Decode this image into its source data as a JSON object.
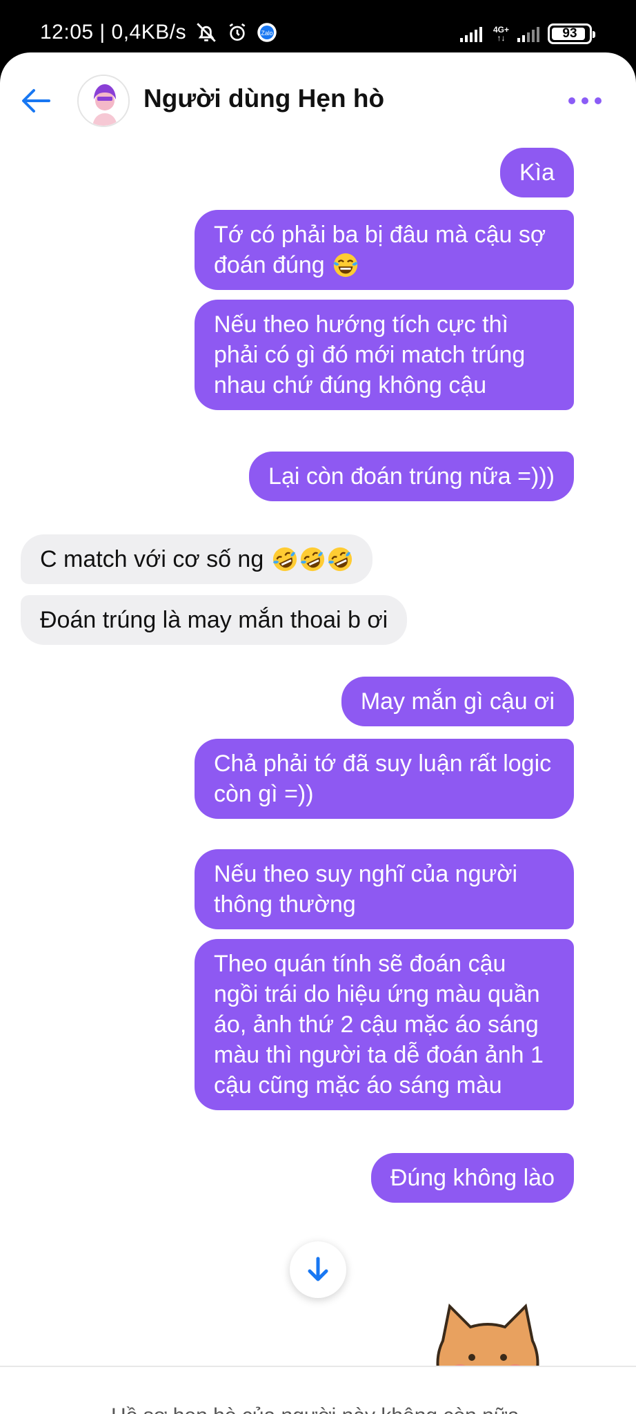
{
  "status_bar": {
    "time_speed": "12:05 | 0,4KB/s",
    "network_label_top": "4G+",
    "network_label_bottom": "↑↓",
    "battery": "93",
    "battery_level": 0.93
  },
  "header": {
    "title": "Người dùng Hẹn hò"
  },
  "messages": [
    {
      "side": "out",
      "text": "Kìa"
    },
    {
      "side": "out",
      "text": "Tớ có phải ba bị đâu mà cậu sợ đoán đúng",
      "emoji": "face-with-tears-of-joy"
    },
    {
      "side": "out",
      "text": "Nếu theo hướng tích cực thì phải có gì đó mới match trúng nhau chứ đúng không cậu"
    },
    {
      "side": "out",
      "text": "Lại còn đoán trúng nữa =)))"
    },
    {
      "side": "in",
      "text": "C match với cơ số ng",
      "emoji": "rolling-on-the-floor-laughing x3"
    },
    {
      "side": "in",
      "text": "Đoán trúng là may mắn thoai b ơi"
    },
    {
      "side": "out",
      "text": "May mắn gì cậu ơi"
    },
    {
      "side": "out",
      "text": "Chả phải tớ đã suy luận rất logic còn gì =))"
    },
    {
      "side": "out",
      "text": "Nếu theo suy nghĩ của người thông thường"
    },
    {
      "side": "out",
      "text": "Theo quán tính sẽ đoán cậu ngồi trái do hiệu ứng màu quần áo, ảnh thứ 2 cậu mặc áo sáng màu thì người ta dễ đoán ảnh 1 cậu cũng mặc áo sáng màu"
    },
    {
      "side": "out",
      "text": "Đúng không lào"
    }
  ],
  "notice": {
    "text": "Hồ sơ hẹn hò của người này không còn nữa."
  },
  "colors": {
    "outgoing_bubble": "#8e59f2",
    "incoming_bubble": "#efeff1",
    "accent_blue": "#1877f2",
    "menu_purple": "#8b5cf6"
  },
  "icons": [
    "back-arrow-icon",
    "avatar",
    "more-options-icon",
    "arrow-down-icon",
    "sticker"
  ]
}
